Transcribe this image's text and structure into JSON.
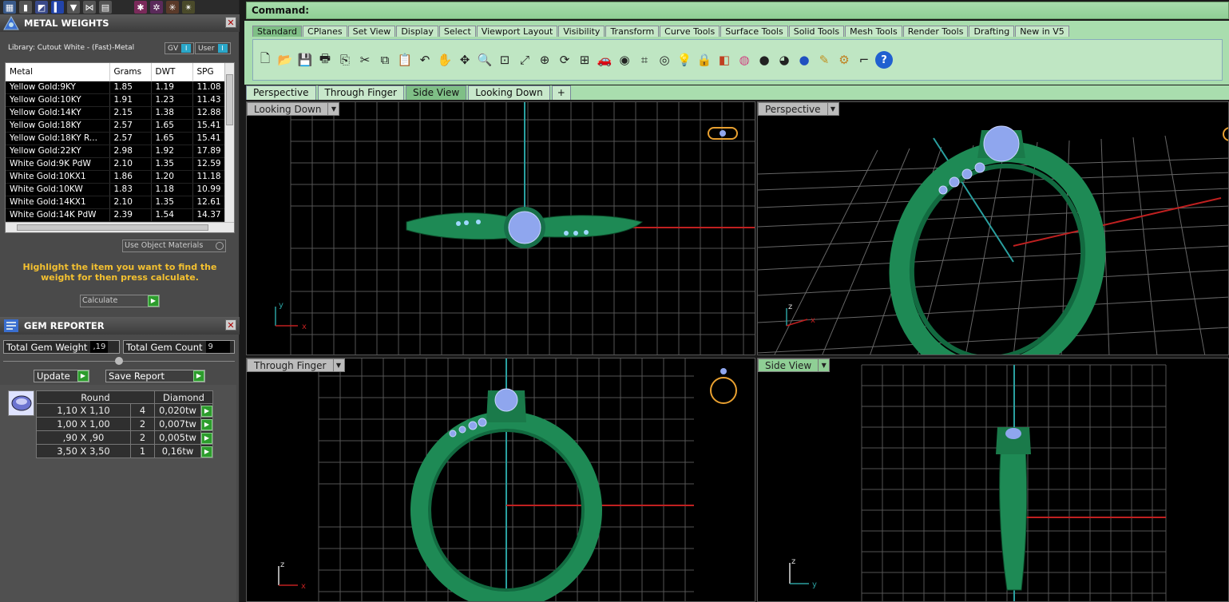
{
  "metal_panel": {
    "title": "METAL WEIGHTS",
    "library": "Library: Cutout White - (Fast)-Metal",
    "gv_label": "GV",
    "user_label": "User",
    "columns": [
      "Metal",
      "Grams",
      "DWT",
      "SPG"
    ],
    "rows": [
      [
        "Yellow Gold:9KY",
        "1.85",
        "1.19",
        "11.08"
      ],
      [
        "Yellow Gold:10KY",
        "1.91",
        "1.23",
        "11.43"
      ],
      [
        "Yellow Gold:14KY",
        "2.15",
        "1.38",
        "12.88"
      ],
      [
        "Yellow Gold:18KY",
        "2.57",
        "1.65",
        "15.41"
      ],
      [
        "Yellow Gold:18KY R...",
        "2.57",
        "1.65",
        "15.41"
      ],
      [
        "Yellow Gold:22KY",
        "2.98",
        "1.92",
        "17.89"
      ],
      [
        "White Gold:9K PdW",
        "2.10",
        "1.35",
        "12.59"
      ],
      [
        "White Gold:10KX1",
        "1.86",
        "1.20",
        "11.18"
      ],
      [
        "White Gold:10KW",
        "1.83",
        "1.18",
        "10.99"
      ],
      [
        "White Gold:14KX1",
        "2.10",
        "1.35",
        "12.61"
      ],
      [
        "White Gold:14K PdW",
        "2.39",
        "1.54",
        "14.37"
      ]
    ],
    "use_object_materials": "Use Object Materials",
    "hint": "Highlight the item you want to find the weight for then press calculate.",
    "calculate": "Calculate"
  },
  "gem_panel": {
    "title": "GEM REPORTER",
    "total_weight_label": "Total Gem Weight",
    "total_weight_value": ",19",
    "total_count_label": "Total Gem Count",
    "total_count_value": "9",
    "update": "Update",
    "save_report": "Save Report",
    "columns": [
      "Round",
      "Diamond"
    ],
    "rows": [
      [
        "1,10 X 1,10",
        "4",
        "0,020tw"
      ],
      [
        "1,00 X 1,00",
        "2",
        "0,007tw"
      ],
      [
        ",90 X ,90",
        "2",
        "0,005tw"
      ],
      [
        "3,50 X 3,50",
        "1",
        "0,16tw"
      ]
    ]
  },
  "command": {
    "label": "Command:"
  },
  "toolbar_tabs": [
    "Standard",
    "CPlanes",
    "Set View",
    "Display",
    "Select",
    "Viewport Layout",
    "Visibility",
    "Transform",
    "Curve Tools",
    "Surface Tools",
    "Solid Tools",
    "Mesh Tools",
    "Render Tools",
    "Drafting",
    "New in V5"
  ],
  "toolbar_icons": [
    "new-icon",
    "open-icon",
    "save-icon",
    "print-icon",
    "import-icon",
    "cut-icon",
    "copy-icon",
    "paste-icon",
    "undo-icon",
    "pan-hand-icon",
    "move-icon",
    "zoom-icon",
    "zoom-window-icon",
    "zoom-extents-icon",
    "zoom-selected-icon",
    "rotate-view-icon",
    "four-views-icon",
    "car-icon",
    "camera-icon",
    "grid-snap-icon",
    "osnap-icon",
    "light-icon",
    "lock-icon",
    "layer-icon",
    "color-wheel-icon",
    "shaded-sphere-icon",
    "render-sphere-icon",
    "blue-sphere-icon",
    "pencil-icon",
    "gear-icon",
    "dimension-icon",
    "help-icon"
  ],
  "view_tabs": [
    "Perspective",
    "Through Finger",
    "Side View",
    "Looking Down"
  ],
  "viewports": {
    "top_left": "Looking Down",
    "top_right": "Perspective",
    "bottom_left": "Through Finger",
    "bottom_right": "Side View"
  },
  "axis": {
    "x": "x",
    "y": "y",
    "z": "z"
  },
  "colors": {
    "ring": "#1e8a55",
    "gem": "#8fa6ee",
    "accent_green": "#a9ddae",
    "hint": "#f3c030"
  }
}
